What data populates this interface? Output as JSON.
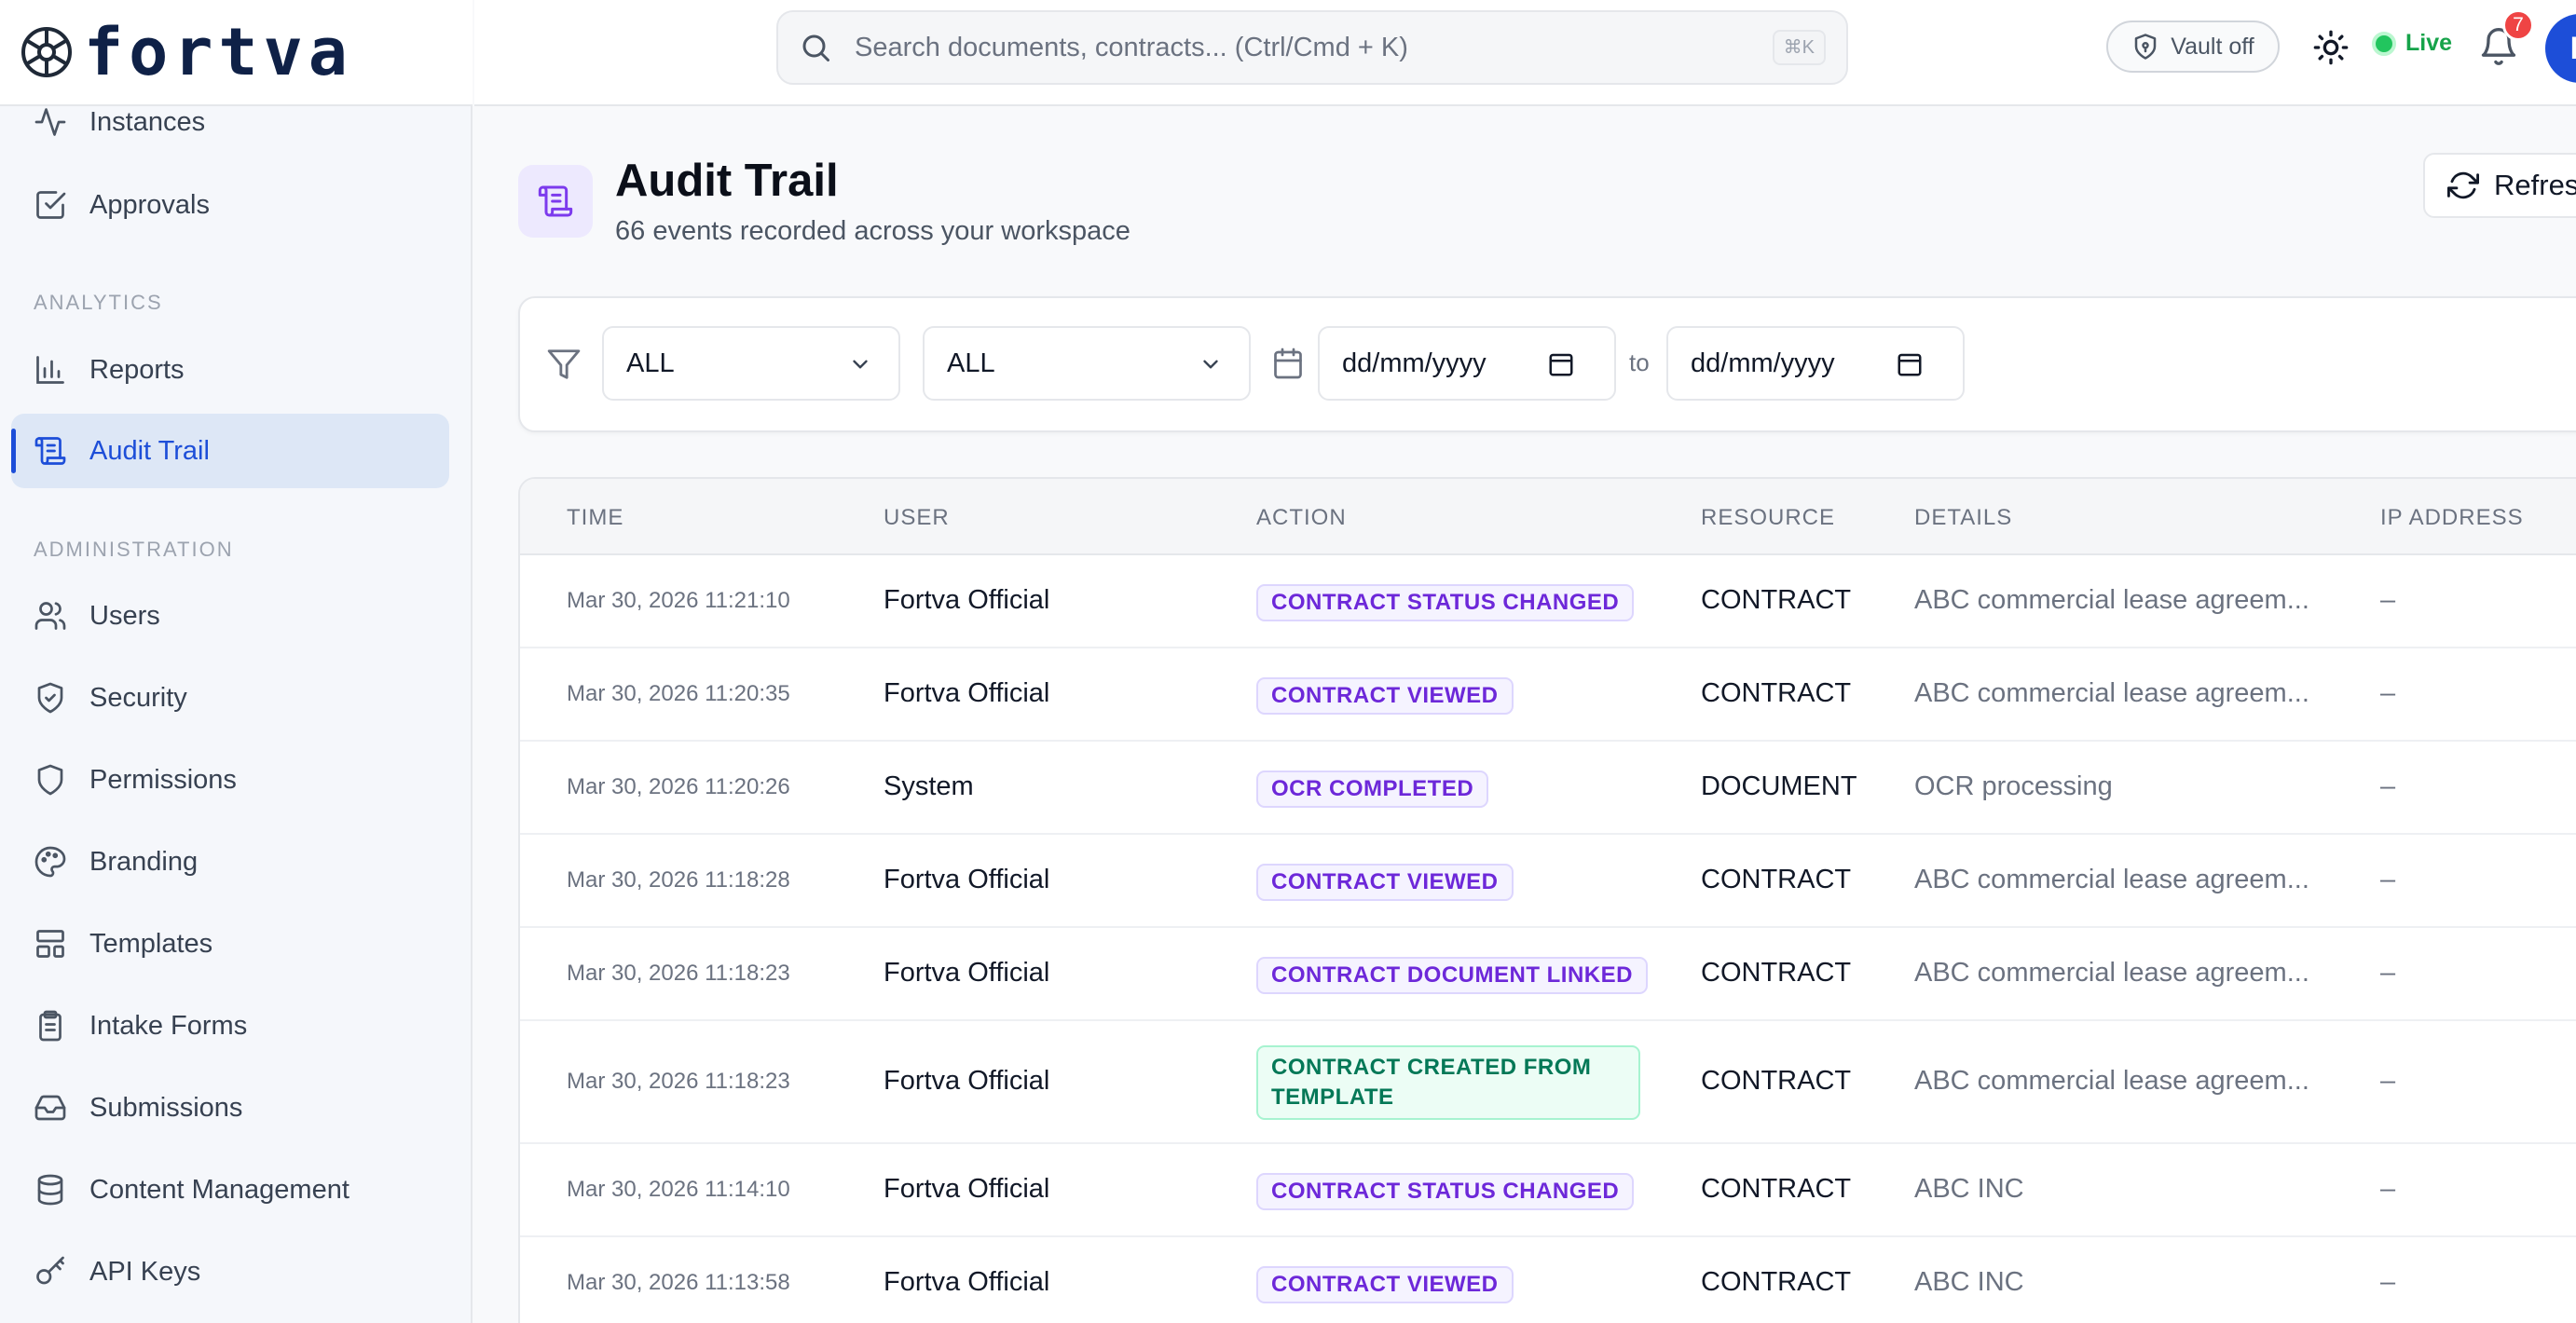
{
  "brand": {
    "name": "fortva"
  },
  "sidebar": {
    "items_top": [
      {
        "label": "Instances",
        "icon": "activity-icon"
      },
      {
        "label": "Approvals",
        "icon": "check-square-icon"
      }
    ],
    "section_analytics": "ANALYTICS",
    "analytics_items": [
      {
        "label": "Reports",
        "icon": "bar-chart-icon"
      },
      {
        "label": "Audit Trail",
        "icon": "scroll-icon",
        "active": true
      }
    ],
    "section_admin": "ADMINISTRATION",
    "admin_items": [
      {
        "label": "Users",
        "icon": "users-icon"
      },
      {
        "label": "Security",
        "icon": "shield-check-icon"
      },
      {
        "label": "Permissions",
        "icon": "shield-icon"
      },
      {
        "label": "Branding",
        "icon": "palette-icon"
      },
      {
        "label": "Templates",
        "icon": "layout-icon"
      },
      {
        "label": "Intake Forms",
        "icon": "clipboard-icon"
      },
      {
        "label": "Submissions",
        "icon": "inbox-icon"
      },
      {
        "label": "Content Management",
        "icon": "database-icon"
      },
      {
        "label": "API Keys",
        "icon": "key-icon"
      }
    ]
  },
  "header": {
    "search_placeholder": "Search documents, contracts... (Ctrl/Cmd + K)",
    "search_shortcut": "⌘K",
    "vault_label": "Vault off",
    "live_label": "Live",
    "notification_count": "7",
    "avatar_initial": "F"
  },
  "page": {
    "title": "Audit Trail",
    "subtitle": "66 events recorded across your workspace",
    "refresh_label": "Refresh"
  },
  "filters": {
    "action_select": "ALL",
    "resource_select": "ALL",
    "date_from": "dd/mm/yyyy",
    "date_to": "dd/mm/yyyy",
    "to_label": "to"
  },
  "table": {
    "columns": [
      "TIME",
      "USER",
      "ACTION",
      "RESOURCE",
      "DETAILS",
      "IP ADDRESS"
    ],
    "rows": [
      {
        "time": "Mar 30, 2026 11:21:10",
        "user": "Fortva Official",
        "action": "CONTRACT STATUS CHANGED",
        "resource": "CONTRACT",
        "details": "ABC commercial lease agreem...",
        "ip": "–"
      },
      {
        "time": "Mar 30, 2026 11:20:35",
        "user": "Fortva Official",
        "action": "CONTRACT VIEWED",
        "resource": "CONTRACT",
        "details": "ABC commercial lease agreem...",
        "ip": "–"
      },
      {
        "time": "Mar 30, 2026 11:20:26",
        "user": "System",
        "action": "OCR COMPLETED",
        "resource": "DOCUMENT",
        "details": "OCR processing",
        "ip": "–"
      },
      {
        "time": "Mar 30, 2026 11:18:28",
        "user": "Fortva Official",
        "action": "CONTRACT VIEWED",
        "resource": "CONTRACT",
        "details": "ABC commercial lease agreem...",
        "ip": "–"
      },
      {
        "time": "Mar 30, 2026 11:18:23",
        "user": "Fortva Official",
        "action": "CONTRACT DOCUMENT LINKED",
        "resource": "CONTRACT",
        "details": "ABC commercial lease agreem...",
        "ip": "–"
      },
      {
        "time": "Mar 30, 2026 11:18:23",
        "user": "Fortva Official",
        "action": "CONTRACT CREATED FROM TEMPLATE",
        "resource": "CONTRACT",
        "details": "ABC commercial lease agreem...",
        "ip": "–"
      },
      {
        "time": "Mar 30, 2026 11:14:10",
        "user": "Fortva Official",
        "action": "CONTRACT STATUS CHANGED",
        "resource": "CONTRACT",
        "details": "ABC INC",
        "ip": "–"
      },
      {
        "time": "Mar 30, 2026 11:13:58",
        "user": "Fortva Official",
        "action": "CONTRACT VIEWED",
        "resource": "CONTRACT",
        "details": "ABC INC",
        "ip": "–"
      }
    ]
  },
  "colors": {
    "accent": "#1d4ed8",
    "action_pill": "#6d28d9",
    "created_pill": "#047857",
    "live": "#22c55e",
    "badge": "#ef4444"
  }
}
